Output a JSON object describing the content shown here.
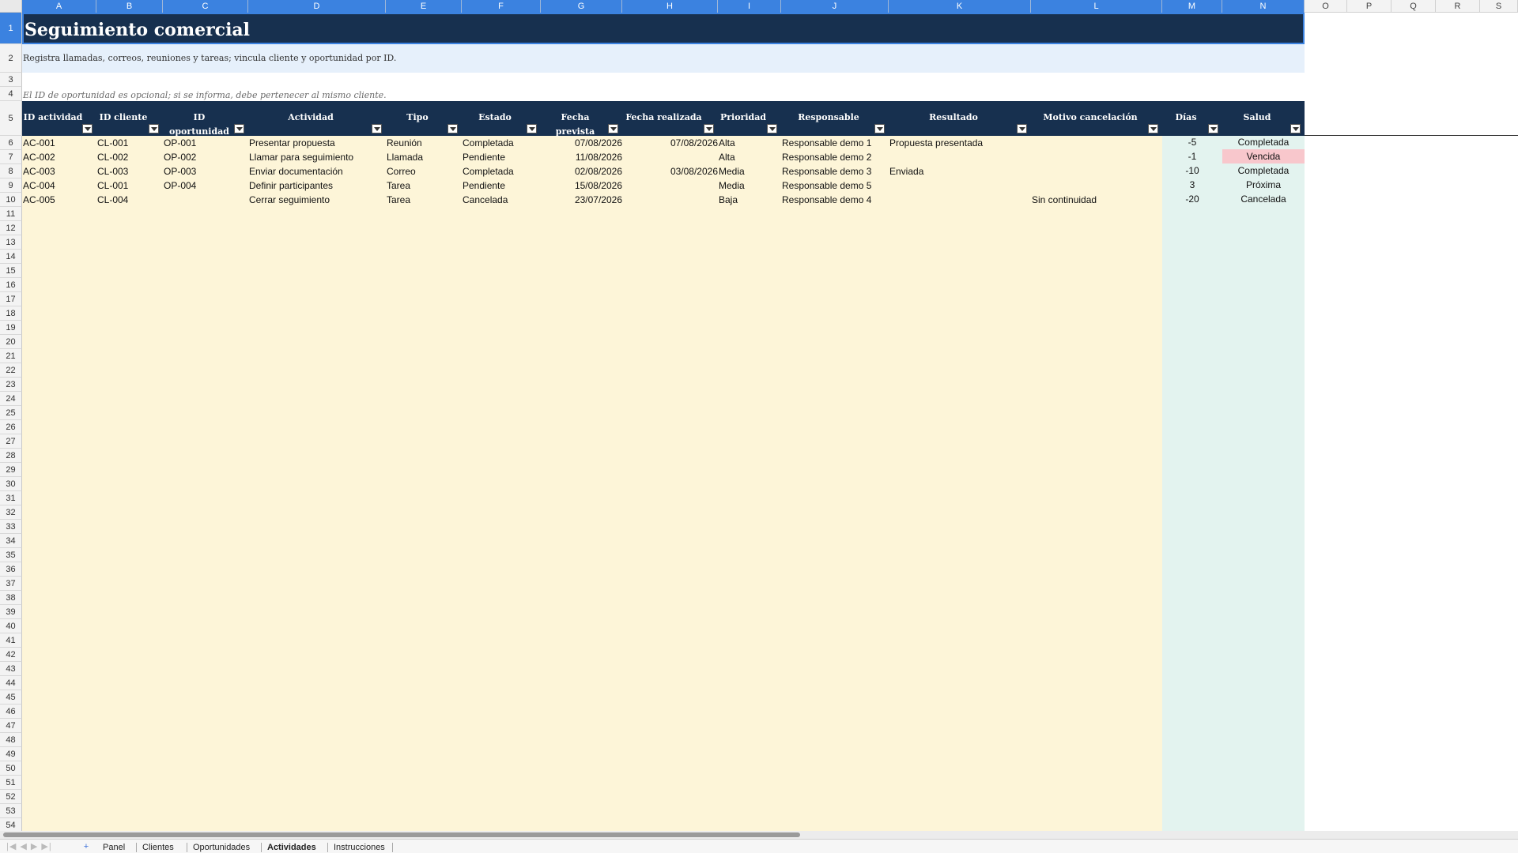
{
  "columns": [
    "A",
    "B",
    "C",
    "D",
    "E",
    "F",
    "G",
    "H",
    "I",
    "J",
    "K",
    "L",
    "M",
    "N",
    "O",
    "P",
    "Q",
    "R",
    "S"
  ],
  "title": "Seguimiento comercial",
  "subtitle": "Registra llamadas, correos, reuniones y tareas; vincula cliente y oportunidad por ID.",
  "note": "El ID de oportunidad es opcional; si se informa, debe pertenecer al mismo cliente.",
  "headers": [
    "ID actividad",
    "ID cliente",
    "ID oportunidad",
    "Actividad",
    "Tipo",
    "Estado",
    "Fecha prevista",
    "Fecha realizada",
    "Prioridad",
    "Responsable",
    "Resultado",
    "Motivo cancelación",
    "Días",
    "Salud"
  ],
  "rows": [
    [
      "AC-001",
      "CL-001",
      "OP-001",
      "Presentar propuesta",
      "Reunión",
      "Completada",
      "07/08/2026",
      "07/08/2026",
      "Alta",
      "Responsable demo 1",
      "Propuesta presentada",
      "",
      "-5",
      "Completada"
    ],
    [
      "AC-002",
      "CL-002",
      "OP-002",
      "Llamar para seguimiento",
      "Llamada",
      "Pendiente",
      "11/08/2026",
      "",
      "Alta",
      "Responsable demo 2",
      "",
      "",
      "-1",
      "Vencida"
    ],
    [
      "AC-003",
      "CL-003",
      "OP-003",
      "Enviar documentación",
      "Correo",
      "Completada",
      "02/08/2026",
      "03/08/2026",
      "Media",
      "Responsable demo 3",
      "Enviada",
      "",
      "-10",
      "Completada"
    ],
    [
      "AC-004",
      "CL-001",
      "OP-004",
      "Definir participantes",
      "Tarea",
      "Pendiente",
      "15/08/2026",
      "",
      "Media",
      "Responsable demo 5",
      "",
      "",
      "3",
      "Próxima"
    ],
    [
      "AC-005",
      "CL-004",
      "",
      "Cerrar seguimiento",
      "Tarea",
      "Cancelada",
      "23/07/2026",
      "",
      "Baja",
      "Responsable demo 4",
      "",
      "Sin continuidad",
      "-20",
      "Cancelada"
    ]
  ],
  "row_numbers": [
    "1",
    "2",
    "3",
    "4",
    "5",
    "6",
    "7",
    "8",
    "9",
    "10",
    "11",
    "12",
    "13",
    "14",
    "15",
    "16",
    "17",
    "18",
    "19",
    "20",
    "21",
    "22",
    "23",
    "24",
    "25",
    "26",
    "27",
    "28",
    "29",
    "30",
    "31",
    "32",
    "33",
    "34",
    "35",
    "36",
    "37",
    "38",
    "39",
    "40",
    "41",
    "42",
    "43",
    "44",
    "45",
    "46",
    "47",
    "48",
    "49",
    "50",
    "51",
    "52",
    "53",
    "54"
  ],
  "sheet_tabs": [
    "Panel",
    "Clientes",
    "Oportunidades",
    "Actividades",
    "Instrucciones"
  ],
  "active_tab": "Actividades",
  "add_sheet_icon": "plus-icon",
  "colors": {
    "title_bg": "#17304f",
    "subtitle_bg": "#e6f0fb",
    "body_bg": "#fdf5d8",
    "calc_bg": "#e3f3ef",
    "vencida_bg": "#f8c7cc",
    "header_sel": "#3b82e0"
  }
}
